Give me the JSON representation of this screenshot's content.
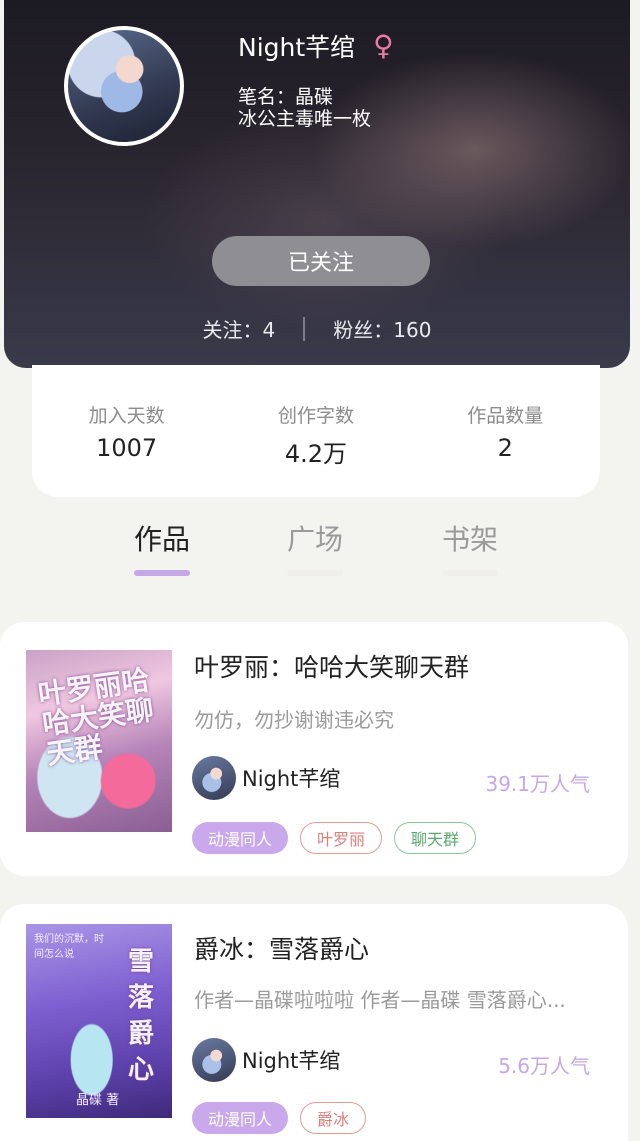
{
  "profile": {
    "name": "Night芊绾",
    "gender_icon": "female-symbol",
    "pen_name": "笔名：晶碟",
    "bio": "冰公主毒唯一枚",
    "follow_button": "已关注",
    "following": "关注：4",
    "followers": "粉丝：160"
  },
  "stats": [
    {
      "label": "加入天数",
      "value": "1007"
    },
    {
      "label": "创作字数",
      "value": "4.2万"
    },
    {
      "label": "作品数量",
      "value": "2"
    }
  ],
  "tabs": [
    {
      "label": "作品",
      "active": true
    },
    {
      "label": "广场",
      "active": false
    },
    {
      "label": "书架",
      "active": false
    }
  ],
  "works": [
    {
      "cover_text": "叶罗丽哈哈大笑聊天群",
      "title": "叶罗丽：哈哈大笑聊天群",
      "description": "勿仿，勿抄谢谢违必究",
      "author": "Night芊绾",
      "popularity": "39.1万人气",
      "tags": [
        "动漫同人",
        "叶罗丽",
        "聊天群"
      ]
    },
    {
      "cover_note": "我们的沉默，时间怎么说",
      "cover_text": "雪落爵心",
      "cover_author": "晶碟 著",
      "title": "爵冰：雪落爵心",
      "description": "作者—晶碟啦啦啦 作者—晶碟 雪落爵心...",
      "author": "Night芊绾",
      "popularity": "5.6万人气",
      "tags": [
        "动漫同人",
        "爵冰"
      ]
    }
  ],
  "colors": {
    "accent_purple": "#c6a7e8",
    "gender_pink": "#e87aa3",
    "tag_red": "#e07e78",
    "tag_green": "#5aa86c"
  }
}
